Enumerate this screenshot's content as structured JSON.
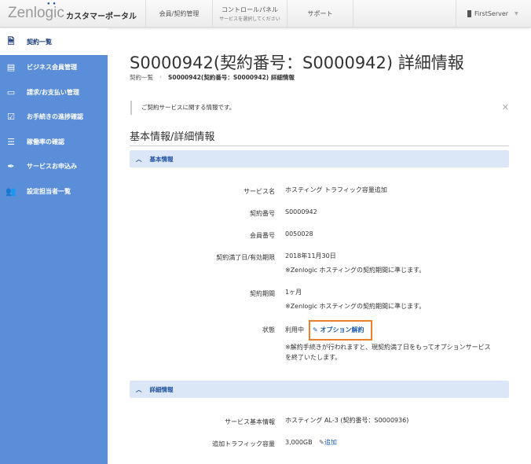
{
  "header": {
    "logo": "Zenlogic",
    "portal": "カスタマーポータル",
    "nav": [
      {
        "label": "会員/契約管理"
      },
      {
        "label": "コントロールパネル",
        "sub": "サービスを選択してください"
      },
      {
        "label": "サポート"
      }
    ],
    "user": "FirstServer"
  },
  "sidebar": {
    "items": [
      {
        "label": "契約一覧",
        "icon": "document-icon"
      },
      {
        "label": "ビジネス会員管理",
        "icon": "id-card-icon"
      },
      {
        "label": "請求/お支払い管理",
        "icon": "billing-icon"
      },
      {
        "label": "お手続きの進捗確認",
        "icon": "checkbox-icon"
      },
      {
        "label": "稼働率の確認",
        "icon": "server-icon"
      },
      {
        "label": "サービスお申込み",
        "icon": "pen-icon"
      },
      {
        "label": "設定担当者一覧",
        "icon": "users-icon"
      }
    ]
  },
  "page": {
    "title": "S0000942(契約番号：S0000942) 詳細情報",
    "breadcrumb": [
      "契約一覧",
      "S0000942(契約番号：S0000942) 詳細情報"
    ],
    "notice": "ご契約サービスに関する情報です。",
    "section": "基本情報/詳細情報"
  },
  "basic": {
    "header": "基本情報",
    "rows": {
      "service": {
        "label": "サービス名",
        "value": "ホスティング トラフィック容量追加"
      },
      "contract_no": {
        "label": "契約番号",
        "value": "S0000942"
      },
      "member_no": {
        "label": "会員番号",
        "value": "0050028"
      },
      "expiry": {
        "label": "契約満了日/有効期限",
        "value": "2018年11月30日",
        "note": "※Zenlogic ホスティングの契約期間に準じます。"
      },
      "period": {
        "label": "契約期間",
        "value": "1ヶ月",
        "note": "※Zenlogic ホスティングの契約期間に準じます。"
      },
      "status": {
        "label": "状態",
        "value": "利用中",
        "action": "オプション解約",
        "note1": "※解約手続きが行われますと、現契約満了日をもってオプションサービス",
        "note2": "を終了いたします。"
      }
    }
  },
  "detail": {
    "header": "詳細情報",
    "rows": {
      "base": {
        "label": "サービス基本情報",
        "value": "ホスティング AL-3 (契約番号：S0000936)"
      },
      "traffic": {
        "label": "追加トラフィック容量",
        "value": "3,000GB",
        "action": "追加"
      }
    }
  }
}
